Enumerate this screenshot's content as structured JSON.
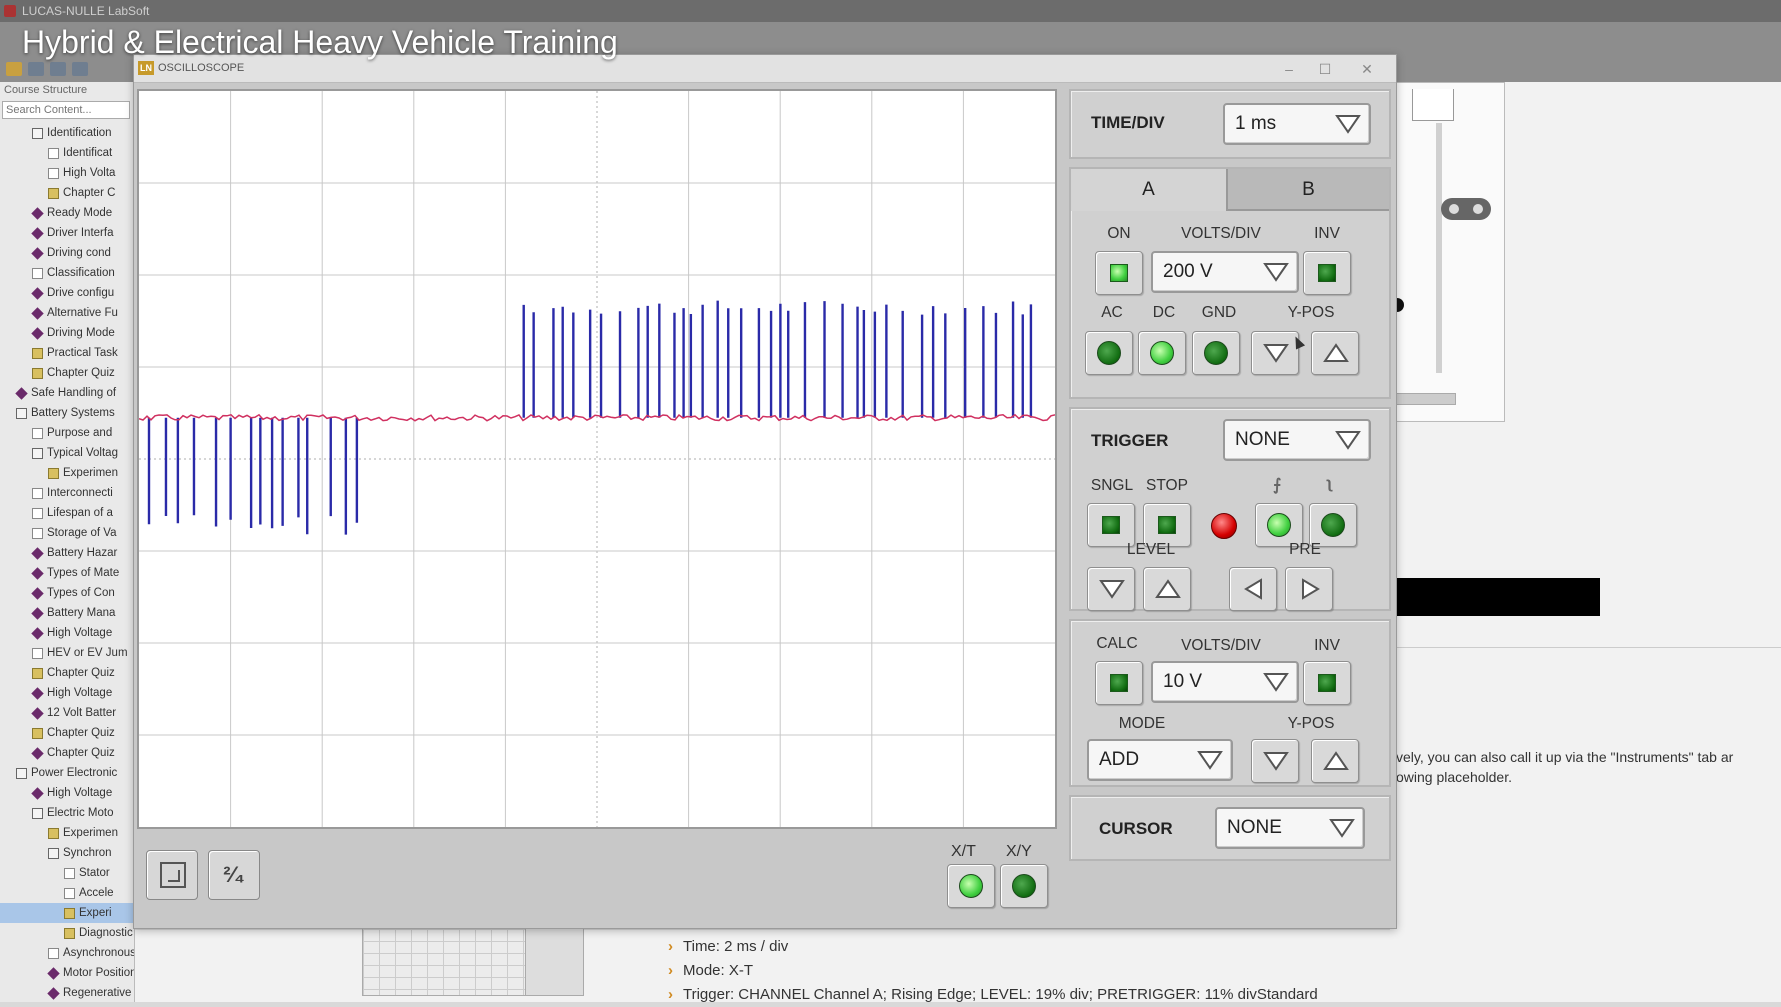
{
  "app": {
    "window_title": "LUCAS-NULLE LabSoft",
    "video_title": "Hybrid & Electrical Heavy Vehicle Training"
  },
  "sidebar": {
    "header": "Course Structure",
    "search_placeholder": "Search Content...",
    "items": [
      {
        "label": "Identification",
        "indent": 2,
        "icon": "book"
      },
      {
        "label": "Identificat",
        "indent": 3,
        "icon": "doc"
      },
      {
        "label": "High Volta",
        "indent": 3,
        "icon": "doc"
      },
      {
        "label": "Chapter C",
        "indent": 3,
        "icon": "quiz"
      },
      {
        "label": "Ready Mode",
        "indent": 2,
        "icon": "gem"
      },
      {
        "label": "Driver Interfa",
        "indent": 2,
        "icon": "gem"
      },
      {
        "label": "Driving cond",
        "indent": 2,
        "icon": "gem"
      },
      {
        "label": "Classification",
        "indent": 2,
        "icon": "doc"
      },
      {
        "label": "Drive configu",
        "indent": 2,
        "icon": "gem"
      },
      {
        "label": "Alternative Fu",
        "indent": 2,
        "icon": "gem"
      },
      {
        "label": "Driving Mode",
        "indent": 2,
        "icon": "gem"
      },
      {
        "label": "Practical Task",
        "indent": 2,
        "icon": "quiz"
      },
      {
        "label": "Chapter Quiz",
        "indent": 2,
        "icon": "quiz"
      },
      {
        "label": "Safe Handling of",
        "indent": 1,
        "icon": "gem"
      },
      {
        "label": "Battery Systems",
        "indent": 1,
        "icon": "book"
      },
      {
        "label": "Purpose and",
        "indent": 2,
        "icon": "doc"
      },
      {
        "label": "Typical Voltag",
        "indent": 2,
        "icon": "book"
      },
      {
        "label": "Experimen",
        "indent": 3,
        "icon": "quiz"
      },
      {
        "label": "Interconnecti",
        "indent": 2,
        "icon": "doc"
      },
      {
        "label": "Lifespan of a",
        "indent": 2,
        "icon": "doc"
      },
      {
        "label": "Storage of Va",
        "indent": 2,
        "icon": "doc"
      },
      {
        "label": "Battery Hazar",
        "indent": 2,
        "icon": "gem"
      },
      {
        "label": "Types of Mate",
        "indent": 2,
        "icon": "gem"
      },
      {
        "label": "Types of Con",
        "indent": 2,
        "icon": "gem"
      },
      {
        "label": "Battery Mana",
        "indent": 2,
        "icon": "gem"
      },
      {
        "label": "High Voltage",
        "indent": 2,
        "icon": "gem"
      },
      {
        "label": "HEV or EV Jum",
        "indent": 2,
        "icon": "doc"
      },
      {
        "label": "Chapter Quiz",
        "indent": 2,
        "icon": "quiz"
      },
      {
        "label": "High Voltage",
        "indent": 2,
        "icon": "gem"
      },
      {
        "label": "12 Volt Batter",
        "indent": 2,
        "icon": "gem"
      },
      {
        "label": "Chapter Quiz",
        "indent": 2,
        "icon": "quiz"
      },
      {
        "label": "Chapter Quiz",
        "indent": 2,
        "icon": "gem"
      },
      {
        "label": "Power Electronic",
        "indent": 1,
        "icon": "book"
      },
      {
        "label": "High Voltage",
        "indent": 2,
        "icon": "gem"
      },
      {
        "label": "Electric Moto",
        "indent": 2,
        "icon": "book"
      },
      {
        "label": "Experimen",
        "indent": 3,
        "icon": "quiz"
      },
      {
        "label": "Synchron",
        "indent": 3,
        "icon": "book"
      },
      {
        "label": "Stator",
        "indent": 4,
        "icon": "doc"
      },
      {
        "label": "Accele",
        "indent": 4,
        "icon": "doc"
      },
      {
        "label": "Experi",
        "indent": 4,
        "icon": "quiz",
        "selected": true
      },
      {
        "label": "Diagnostic task: Malfunction of t...",
        "indent": 4,
        "icon": "quiz"
      },
      {
        "label": "Asynchronous Motors",
        "indent": 3,
        "icon": "doc"
      },
      {
        "label": "Motor Position Sensors (Resolvers a...",
        "indent": 3,
        "icon": "gem"
      },
      {
        "label": "Regenerative Braking",
        "indent": 3,
        "icon": "gem"
      }
    ]
  },
  "oscilloscope": {
    "window_title": "OSCILLOSCOPE",
    "window_icon": "LN",
    "min_glyph": "–",
    "max_glyph": "☐",
    "close_glyph": "✕",
    "time_div": {
      "label": "TIME/DIV",
      "value": "1 ms"
    },
    "channel_tabs": [
      "A",
      "B"
    ],
    "channel_a": {
      "on_label": "ON",
      "volts_label": "VOLTS/DIV",
      "volts_value": "200 V",
      "inv_label": "INV",
      "ac_label": "AC",
      "dc_label": "DC",
      "gnd_label": "GND",
      "ypos_label": "Y-POS"
    },
    "trigger": {
      "label": "TRIGGER",
      "value": "NONE",
      "sngl_label": "SNGL",
      "stop_label": "STOP",
      "rising_glyph": "⨍",
      "falling_glyph": "ʅ",
      "level_label": "LEVEL",
      "pre_label": "PRE"
    },
    "calc": {
      "calc_label": "CALC",
      "volts_label": "VOLTS/DIV",
      "volts_value": "10 V",
      "inv_label": "INV",
      "mode_label": "MODE",
      "mode_value": "ADD",
      "ypos_label": "Y-POS"
    },
    "cursor": {
      "label": "CURSOR",
      "value": "NONE"
    },
    "bottom": {
      "page_label": "²⁄₄",
      "xt_label": "X/T",
      "xy_label": "X/Y"
    },
    "colors": {
      "trace": "#2a2aa8",
      "baseline": "#d03060",
      "grid": "#c8c8c8",
      "led_on": "#3fcf3f",
      "led_off": "#106b10",
      "led_red": "#d40000"
    }
  },
  "background": {
    "text_lines": [
      "vely, you can also call it up via the \"Instruments\" tab ar",
      "owing placeholder."
    ],
    "info_list": [
      "Time: 2 ms / div",
      "Mode: X-T",
      "Trigger: CHANNEL Channel A; Rising Edge; LEVEL: 19% div; PRETRIGGER: 11% divStandard"
    ]
  }
}
